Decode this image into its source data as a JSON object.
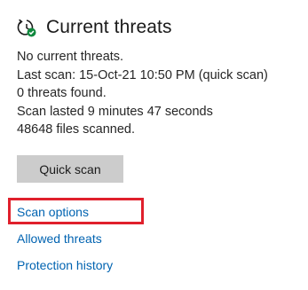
{
  "header": {
    "title": "Current threats",
    "icon": "virus-scan-shield-icon",
    "icon_badge_color": "#10893e"
  },
  "status": {
    "line1": "No current threats.",
    "line2": "Last scan: 15-Oct-21 10:50 PM (quick scan)",
    "line3": "0 threats found.",
    "line4": "Scan lasted 9 minutes 47 seconds",
    "line5": "48648 files scanned."
  },
  "actions": {
    "quick_scan_label": "Quick scan"
  },
  "links": {
    "scan_options": "Scan options",
    "allowed_threats": "Allowed threats",
    "protection_history": "Protection history"
  },
  "colors": {
    "link": "#0063b1",
    "button_bg": "#cccccc",
    "highlight": "#e0202c"
  }
}
